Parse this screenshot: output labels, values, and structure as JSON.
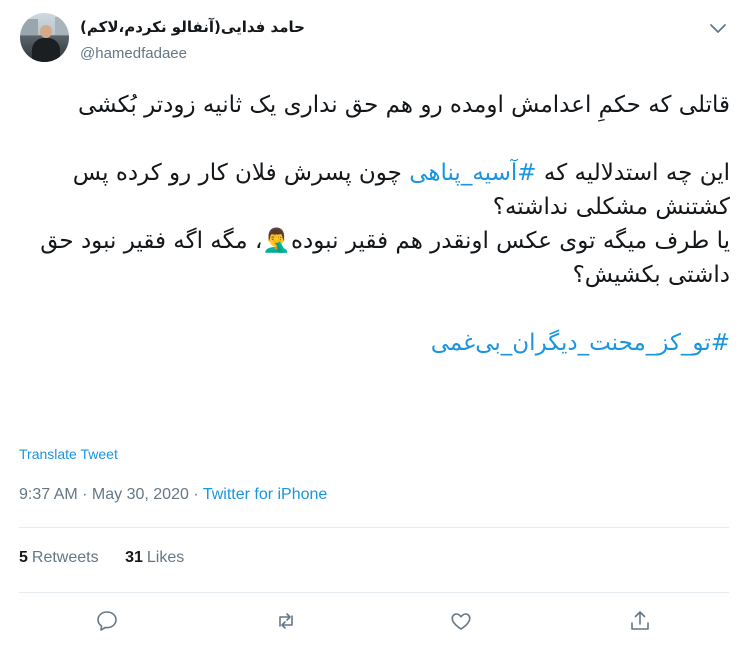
{
  "author": {
    "display_name": "حامد فدایی(آنفالو نکردم،لاکم)",
    "handle": "@hamedfadaee"
  },
  "tweet": {
    "line1": "قاتلی که حکمِ اعدامش اومده رو هم حق نداری یک ثانیه زودتر بُکشی",
    "line2_pre": "این چه استدلالیه که ",
    "hashtag1": "#آسیه_پناهی",
    "line2_post": " چون پسرش فلان کار رو کرده پس کشتنش مشکلی نداشته؟",
    "line3": "یا طرف میگه توی عکس اونقدر هم فقیر نبوده🤦‍♂️، مگه اگه فقیر نبود حق داشتی بکشیش؟",
    "hashtag2": "#تو_کز_محنت_دیگران_بی‌غمی"
  },
  "translate_label": "Translate Tweet",
  "meta": {
    "time": "9:37 AM",
    "separator1": " · ",
    "date": "May 30, 2020",
    "separator2": " · ",
    "source": "Twitter for iPhone"
  },
  "stats": {
    "retweets_count": "5",
    "retweets_label": "Retweets",
    "likes_count": "31",
    "likes_label": "Likes"
  },
  "icons": {
    "caret": "chevron-down-icon",
    "reply": "reply-icon",
    "retweet": "retweet-icon",
    "like": "heart-icon",
    "share": "share-icon"
  },
  "colors": {
    "link": "#1b95e0",
    "secondary_text": "#657786",
    "primary_text": "#14171a",
    "divider": "#e6ecf0"
  }
}
